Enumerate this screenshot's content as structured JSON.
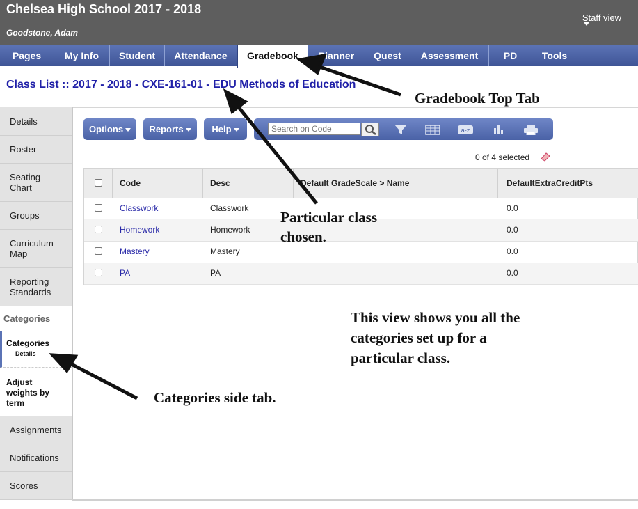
{
  "header": {
    "school": "Chelsea High School 2017 - 2018",
    "user": "Goodstone, Adam",
    "staff_view": "Staff view"
  },
  "tabs": [
    {
      "label": "Pages"
    },
    {
      "label": "My Info"
    },
    {
      "label": "Student"
    },
    {
      "label": "Attendance"
    },
    {
      "label": "Gradebook",
      "active": true
    },
    {
      "label": "Planner"
    },
    {
      "label": "Quest"
    },
    {
      "label": "Assessment"
    },
    {
      "label": "PD"
    },
    {
      "label": "Tools"
    }
  ],
  "breadcrumb": {
    "root": "Class List",
    "separator": "::",
    "class_name": "2017 - 2018 - CXE-161-01 - EDU Methods of Education"
  },
  "sidebar": {
    "items_top": [
      {
        "label": "Details"
      },
      {
        "label": "Roster"
      },
      {
        "label": "Seating Chart"
      },
      {
        "label": "Groups"
      },
      {
        "label": "Curriculum Map"
      },
      {
        "label": "Reporting Standards"
      }
    ],
    "section_heading": "Categories",
    "sub_items": [
      {
        "label": "Categories",
        "detail": "Details",
        "selected": true
      },
      {
        "label": "Adjust weights by term"
      }
    ],
    "items_bottom": [
      {
        "label": "Assignments"
      },
      {
        "label": "Notifications"
      },
      {
        "label": "Scores"
      }
    ]
  },
  "toolbar": {
    "options": "Options",
    "reports": "Reports",
    "help": "Help",
    "search_placeholder": "Search on Code",
    "icons": [
      "filter-icon",
      "grid-icon",
      "sort-az-icon",
      "chart-icon",
      "print-icon"
    ]
  },
  "selection": {
    "text": "0 of 4 selected"
  },
  "table": {
    "columns": [
      "Code",
      "Desc",
      "Default GradeScale > Name",
      "DefaultExtraCreditPts"
    ],
    "rows": [
      {
        "code": "Classwork",
        "desc": "Classwork",
        "scale": "",
        "extra": "0.0"
      },
      {
        "code": "Homework",
        "desc": "Homework",
        "scale": "",
        "extra": "0.0"
      },
      {
        "code": "Mastery",
        "desc": "Mastery",
        "scale": "",
        "extra": "0.0"
      },
      {
        "code": "PA",
        "desc": "PA",
        "scale": "",
        "extra": "0.0"
      }
    ]
  },
  "annotations": {
    "gradebook": "Gradebook Top Tab",
    "class_line1": "Particular class",
    "class_line2": "chosen.",
    "view_line1": "This view shows you all the",
    "view_line2": "categories set up for a",
    "view_line3": "particular class.",
    "side_tab": "Categories side tab."
  },
  "colors": {
    "header_bg": "#5e5e5e",
    "tab_bar": "#4a62a6",
    "link": "#2020a8"
  }
}
